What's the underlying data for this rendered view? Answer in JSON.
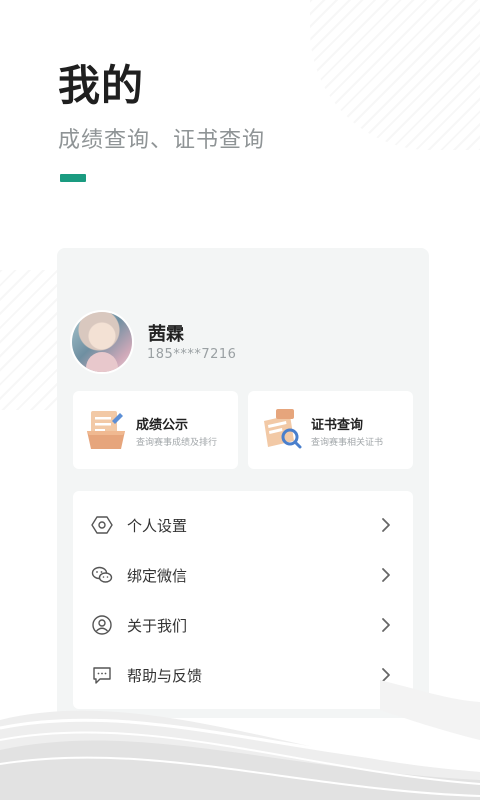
{
  "header": {
    "title": "我的",
    "subtitle": "成绩查询、证书查询"
  },
  "colors": {
    "accent": "#1a9b80",
    "panel_bg": "#f3f5f5",
    "muted_text": "#9aa0a3"
  },
  "user": {
    "name": "茜霖",
    "phone": "185****7216"
  },
  "quick_actions": [
    {
      "title": "成绩公示",
      "desc": "查询赛事成绩及排行",
      "icon": "score-report-icon"
    },
    {
      "title": "证书查询",
      "desc": "查询赛事相关证书",
      "icon": "certificate-search-icon"
    }
  ],
  "menu": [
    {
      "label": "个人设置",
      "icon": "settings-icon"
    },
    {
      "label": "绑定微信",
      "icon": "wechat-icon"
    },
    {
      "label": "关于我们",
      "icon": "user-circle-icon"
    },
    {
      "label": "帮助与反馈",
      "icon": "feedback-icon"
    }
  ]
}
